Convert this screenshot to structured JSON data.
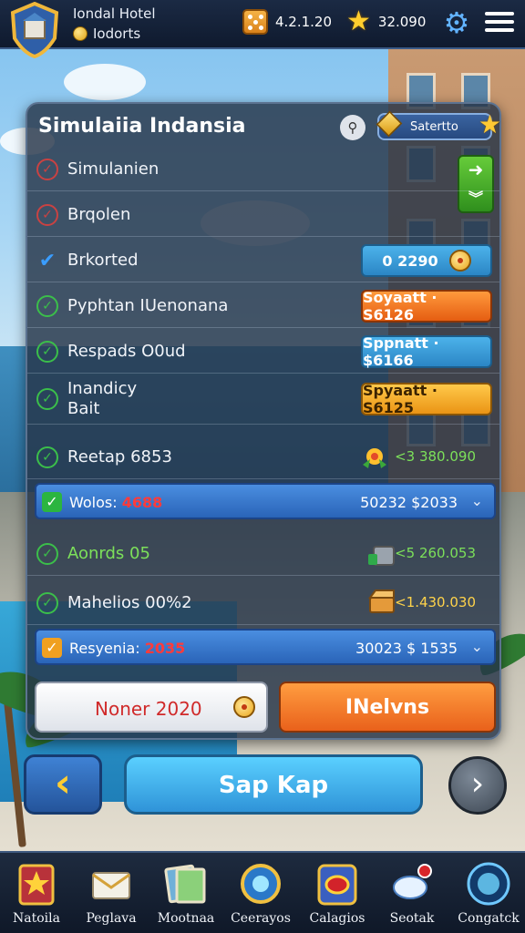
{
  "header": {
    "hotel_name": "Iondal Hotel",
    "hotel_sub": "Iodorts",
    "dice_value": "4.2.1.20",
    "star_value": "32.090"
  },
  "panel": {
    "title": "Simulaiia Indansia",
    "settings_label": "Satertto",
    "rows": [
      {
        "label": "Simulanien",
        "status": "x"
      },
      {
        "label": "Brqolen",
        "status": "x"
      },
      {
        "label": "Brkorted",
        "status": "check",
        "button": "0 2290"
      },
      {
        "label": "Pyphtan IUenonana",
        "status": "done",
        "button": "Soyaatt · S6126"
      },
      {
        "label": "Respads O0ud",
        "status": "done",
        "button": "Sppnatt · $6166"
      },
      {
        "label_line1": "Inandicy",
        "label_line2": "Bait",
        "status": "done",
        "button": "Spyaatt · S6125"
      },
      {
        "label": "Reetap 6853",
        "status": "done",
        "reward": "<3 380.090"
      },
      {
        "label": "Aonrds 05",
        "status": "done",
        "reward": "<5 260.053"
      },
      {
        "label": "Mahelios 00%2",
        "status": "done",
        "reward": "<1.430.030"
      }
    ],
    "banner1": {
      "label": "Wolos: ",
      "highlight": "4688",
      "value": "50232 $2033"
    },
    "banner2": {
      "label": "Resyenia: ",
      "highlight": "2035",
      "value": "30023 $ 1535"
    },
    "btn_left": "Noner 2020",
    "btn_right": "INelvns"
  },
  "nav": {
    "main_label": "Sap Kap"
  },
  "dock": [
    {
      "label": "Natoila",
      "icon": "star-card-icon"
    },
    {
      "label": "Peglava",
      "icon": "envelope-icon"
    },
    {
      "label": "Mootnaa",
      "icon": "photos-icon"
    },
    {
      "label": "Ceerayos",
      "icon": "compass-icon"
    },
    {
      "label": "Calagios",
      "icon": "gem-card-icon"
    },
    {
      "label": "Seotak",
      "icon": "cloud-badge-icon"
    },
    {
      "label": "Congatck",
      "icon": "orb-icon"
    }
  ],
  "colors": {
    "accent_blue": "#2b86c5",
    "accent_orange": "#e55d12",
    "success_green": "#3bbf4a",
    "reward_green": "#7ce05a",
    "highlight_red": "#ff3b3b"
  }
}
